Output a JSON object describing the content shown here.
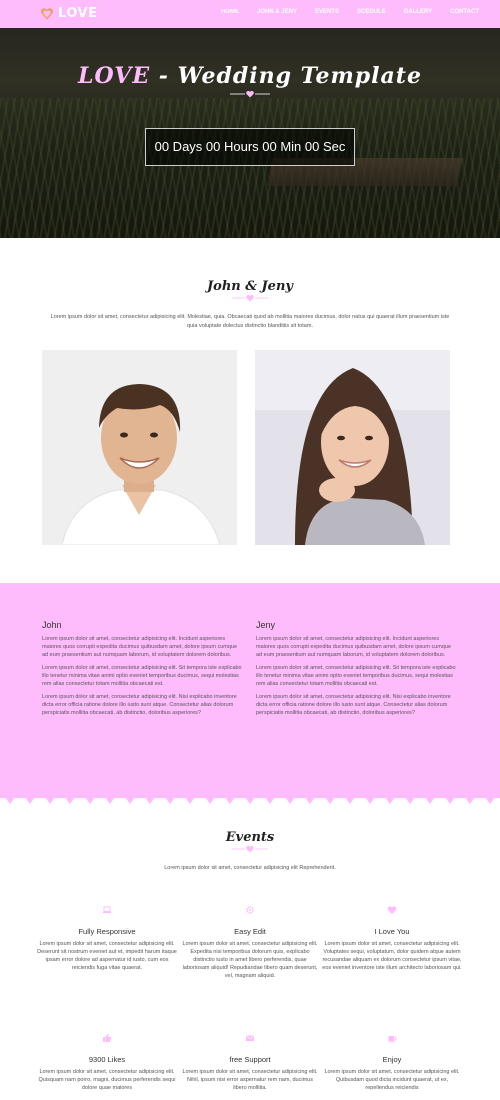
{
  "brand": {
    "logo_text": "LOVE",
    "accent": "#ffbcfc"
  },
  "nav": {
    "items": [
      {
        "label": "HOME"
      },
      {
        "label": "JOHN & JENY"
      },
      {
        "label": "EVENTS"
      },
      {
        "label": "SCEDULE"
      },
      {
        "label": "GALLERY"
      },
      {
        "label": "CONTACT"
      }
    ]
  },
  "hero": {
    "title_love": "LOVE",
    "title_rest": " - Wedding Template",
    "countdown": "00 Days 00 Hours 00 Min 00 Sec"
  },
  "couple": {
    "title": "John & Jeny",
    "intro": "Lorem ipsum dolor sit amet, consectetur adipisicing elit. Molestiae, quia. Obcaecati quod ab mollitia maiores ducimus, dolor natus qui quaerat illum praesentium iste quia voluptate dolectus distinctio blanditiis sit totam."
  },
  "bio": {
    "john": {
      "name": "John",
      "paragraphs": [
        "Lorem ipsum dolor sit amet, consectetur adipisicing elit. Incidunt asperiores maiores quos corrupti expedita ducimus quibusdam amet, dolore ipsum cumque ad eum praesentium aut numquam laborum, id voluptatem dolorem doloribus.",
        "Lorem ipsum dolor sit amet, consectetur adipisicing elit. Sit tempora iste explicabo illo tenetur minima vitae animi optio eveniet temporibus ducimus, sequi molestias rem alias consectetur totam mollitia obcaecati est.",
        "Lorem ipsum dolor sit amet, consectetur adipisicing elit. Nisi explicabo inventore dicta error officia ratione dolore illo iusto sunt atque. Consectetur alias dolorum perspiciatis mollitia obcaecati, ab distinctio, doloribus asperiores?"
      ]
    },
    "jeny": {
      "name": "Jeny",
      "paragraphs": [
        "Lorem ipsum dolor sit amet, consectetur adipisicing elit. Incidunt asperiores maiores quos corrupti expedita ducimus quibusdam amet, dolore ipsum cumque ad eum praesentium aut numquam laborum, id voluptatem dolorem doloribus.",
        "Lorem ipsum dolor sit amet, consectetur adipisicing elit. Sit tempora iste explicabo illo tenetur minima vitae animi optio eveniet temporibus ducimus, sequi molestias rem alias consectetur totam mollitia obcaecati est.",
        "Lorem ipsum dolor sit amet, consectetur adipisicing elit. Nisi explicabo inventore dicta error officia ratione dolore illo iusto sunt atque. Consectetur alias dolorum perspiciatis mollitia obcaecati, ab distinctio, doloribus asperiores?"
      ]
    }
  },
  "events": {
    "title": "Events",
    "intro": "Lorem ipsum dolor sit amet, consectetur adipisicing elit Reprehenderit.",
    "features": [
      {
        "icon": "laptop-icon",
        "title": "Fully Responsive",
        "text": "Lorem ipsum dolor sit amet, consectetur adipisicing elit. Deserunt sit nostrum eveniet aut et, impedit harum itaque ipsam error dolore ad aspernatur id iusto, cum eos reiciendis fuga vitae quaerat."
      },
      {
        "icon": "gear-icon",
        "title": "Easy Edit",
        "text": "Lorem ipsum dolor sit amet, consectetur adipisicing elit. Expedita nisi temporibus dolorum quis, explicabo distinctio iusto in amet libero perferendis, quae laboriosam aliquid! Repudiandae libero quam deserunt, vel, magnam aliquid."
      },
      {
        "icon": "heart-icon",
        "title": "I Love You",
        "text": "Lorem ipsum dolor sit amet, consectetur adipisicing elit. Voluptates sequi, voluptatum, dolor quidem atque autem recusandae aliquam ex dolorum consectetur ipsum vitae, eos eveniet inventore iste illum architecto laboriosam qui."
      },
      {
        "icon": "thumbs-up-icon",
        "title": "9300 Likes",
        "text": "Lorem ipsum dolor sit amet, consectetur adipisicing elit. Quisquam nam porro, magni, ducimus perferendis sequi dolore quae maiores"
      },
      {
        "icon": "envelope-icon",
        "title": "free Support",
        "text": "Lorem ipsum dolor sit amet, consectetur adipisicing elit. Nihil, ipsum nisi error aspernatur rem nam, ducimus libero mollitia."
      },
      {
        "icon": "coffee-icon",
        "title": "Enjoy",
        "text": "Lorem ipsum dolor sit amet, consectetur adipisicing elit. Quibusdam quod dicta incidunt quaerat, ut ex, repellendus reiciendis"
      }
    ]
  }
}
